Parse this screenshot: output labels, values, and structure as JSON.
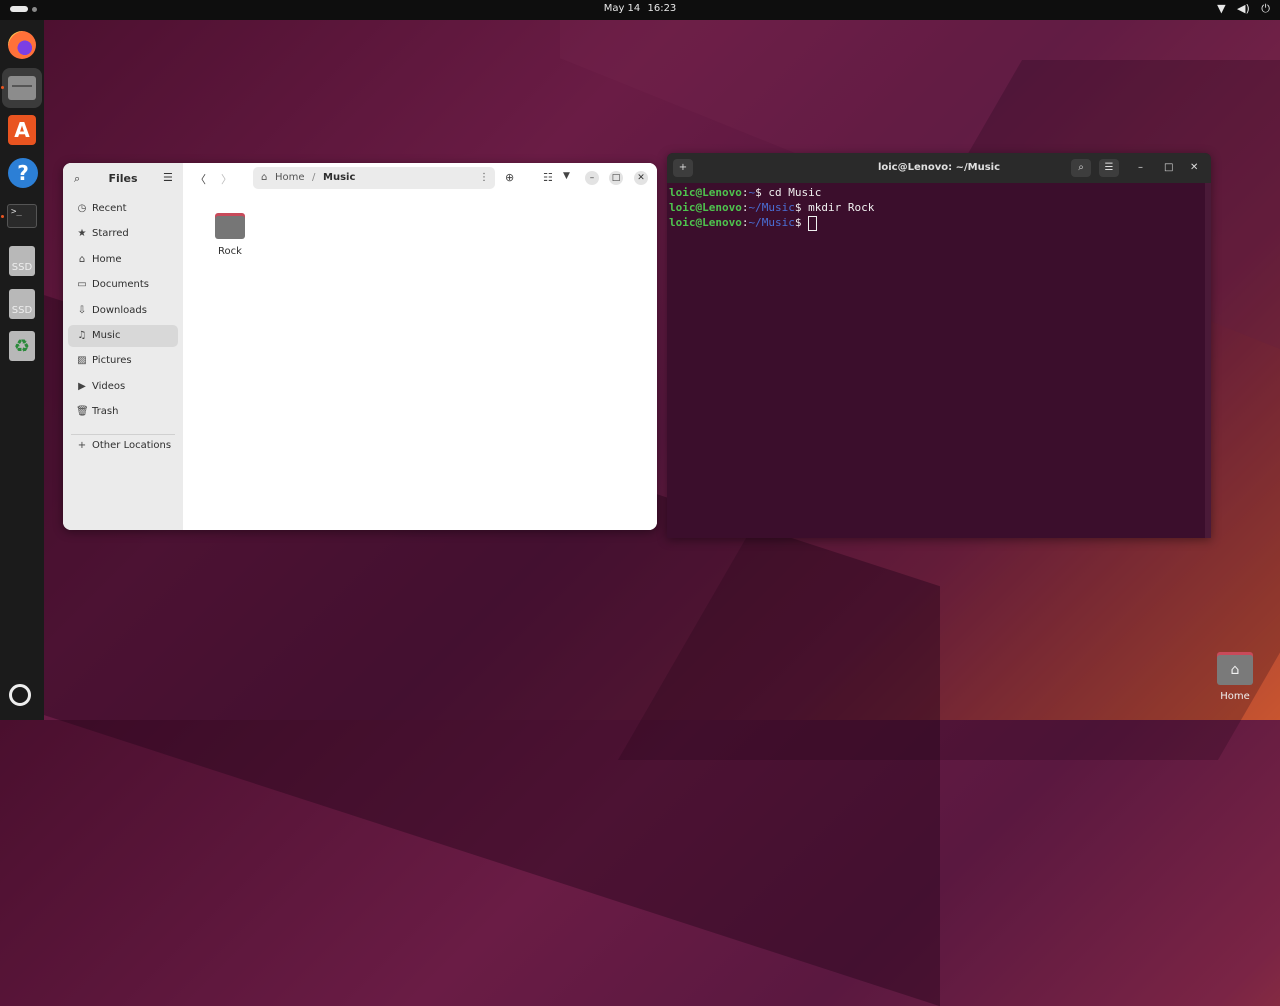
{
  "topbar": {
    "date": "May 14",
    "time": "16:23",
    "icons": [
      "wifi-icon",
      "volume-icon",
      "power-icon"
    ]
  },
  "dock": {
    "items": [
      {
        "name": "firefox"
      },
      {
        "name": "files"
      },
      {
        "name": "app-center"
      },
      {
        "name": "help"
      },
      {
        "name": "terminal",
        "glyph": ">_"
      },
      {
        "name": "ssd-drive-1",
        "label": "SSD"
      },
      {
        "name": "ssd-drive-2",
        "label": "SSD"
      },
      {
        "name": "trash",
        "glyph": "♻"
      }
    ]
  },
  "files": {
    "title": "Files",
    "sidebar": [
      {
        "label": "Recent",
        "icon": "clock-icon",
        "glyph": "◷"
      },
      {
        "label": "Starred",
        "icon": "star-icon",
        "glyph": "★"
      },
      {
        "label": "Home",
        "icon": "home-icon",
        "glyph": "⌂"
      },
      {
        "label": "Documents",
        "icon": "document-icon",
        "glyph": "▭"
      },
      {
        "label": "Downloads",
        "icon": "download-icon",
        "glyph": "⇩"
      },
      {
        "label": "Music",
        "icon": "music-icon",
        "glyph": "♫",
        "selected": true
      },
      {
        "label": "Pictures",
        "icon": "picture-icon",
        "glyph": "▨"
      },
      {
        "label": "Videos",
        "icon": "video-icon",
        "glyph": "▶"
      },
      {
        "label": "Trash",
        "icon": "trash-icon",
        "glyph": "🗑"
      }
    ],
    "other_locations": {
      "label": "Other Locations",
      "glyph": "+"
    },
    "path": [
      "Home",
      "Music"
    ],
    "path_separator": "/",
    "items": [
      {
        "name": "Rock",
        "type": "folder"
      }
    ]
  },
  "terminal": {
    "title": "loic@Lenovo: ~/Music",
    "lines": [
      {
        "user": "loic@Lenovo",
        "colon": ":",
        "path": "~",
        "prompt": "$ ",
        "command": "cd Music"
      },
      {
        "user": "loic@Lenovo",
        "colon": ":",
        "path": "~/Music",
        "prompt": "$ ",
        "command": "mkdir Rock"
      },
      {
        "user": "loic@Lenovo",
        "colon": ":",
        "path": "~/Music",
        "prompt": "$ ",
        "command": ""
      }
    ]
  },
  "desktop": {
    "icons": [
      {
        "label": "Home"
      }
    ]
  }
}
